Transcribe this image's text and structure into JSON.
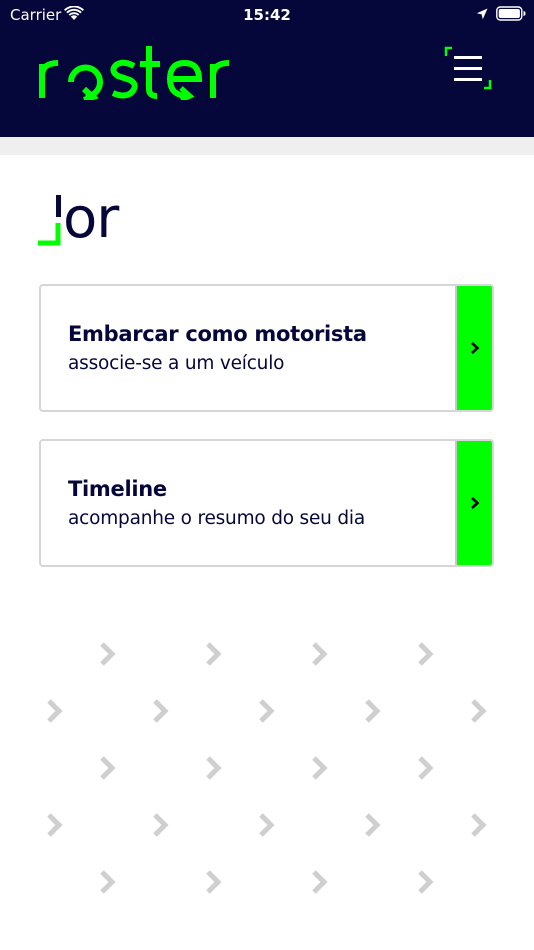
{
  "status_bar": {
    "carrier": "Carrier",
    "time": "15:42"
  },
  "header": {
    "logo_text": "roster",
    "background_color": "#05073a",
    "accent_color": "#00ff00"
  },
  "section_logo_text": "or",
  "cards": [
    {
      "title": "Embarcar como motorista",
      "subtitle": "associe-se a um veículo"
    },
    {
      "title": "Timeline",
      "subtitle": "acompanhe o resumo do seu dia"
    }
  ],
  "icons": {
    "wifi": "wifi-icon",
    "location": "location-arrow-icon",
    "battery": "battery-icon",
    "menu": "hamburger-menu-icon",
    "card_arrow": "chevron-right-icon",
    "pattern": "chevron-pattern-icon"
  }
}
